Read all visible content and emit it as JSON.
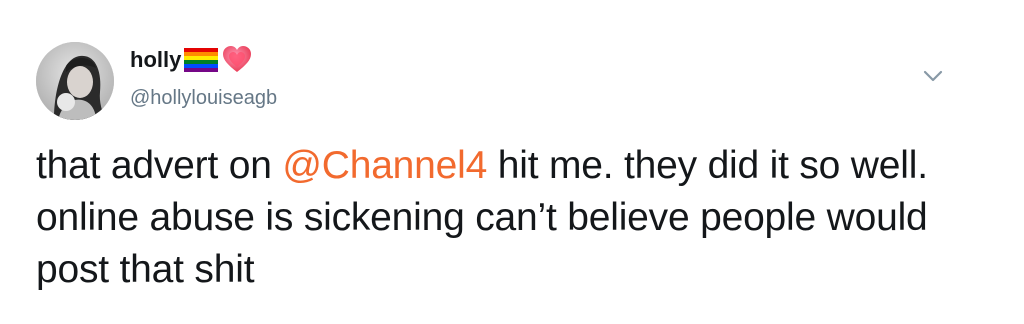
{
  "user": {
    "display_name": "holly",
    "handle": "@hollylouiseagb"
  },
  "icons": {
    "flag": "rainbow-flag-icon",
    "heart": "sparkling-heart-icon",
    "caret": "chevron-down-icon",
    "avatar": "profile-photo"
  },
  "tweet": {
    "text_before": "that advert on ",
    "mention": "@Channel4",
    "text_after": " hit me. they did it so well. online abuse is sickening can’t believe people would post that shit"
  },
  "colors": {
    "mention": "#f26a2e",
    "handle": "#657786",
    "text": "#14171a",
    "caret": "#8899a6"
  }
}
